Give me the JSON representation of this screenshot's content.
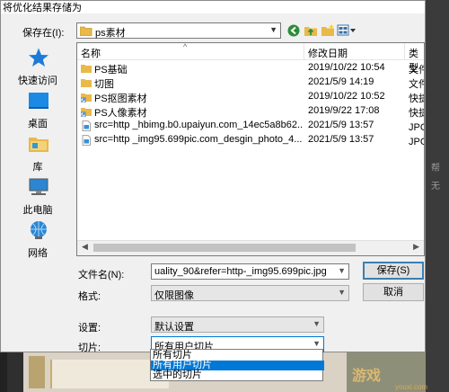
{
  "window": {
    "title": "将优化结果存储为"
  },
  "save_in": {
    "label": "保存在(I):",
    "value": "ps素材"
  },
  "places": [
    {
      "label": "快速访问",
      "icon": "star-icon"
    },
    {
      "label": "桌面",
      "icon": "desktop-icon"
    },
    {
      "label": "库",
      "icon": "library-icon"
    },
    {
      "label": "此电脑",
      "icon": "computer-icon"
    },
    {
      "label": "网络",
      "icon": "network-icon"
    }
  ],
  "list": {
    "columns": {
      "name": "名称",
      "date": "修改日期",
      "type": "类型"
    },
    "rows": [
      {
        "name": "PS基础",
        "date": "2019/10/22 10:54",
        "type": "文件夹",
        "icon": "folder-icon"
      },
      {
        "name": "切图",
        "date": "2021/5/9 14:19",
        "type": "文件夹",
        "icon": "folder-icon"
      },
      {
        "name": "PS抠图素材",
        "date": "2019/10/22 10:52",
        "type": "快捷方",
        "icon": "shortcut-icon"
      },
      {
        "name": "PS人像素材",
        "date": "2019/9/22 17:08",
        "type": "快捷方",
        "icon": "shortcut-icon"
      },
      {
        "name": "src=http _hbimg.b0.upaiyun.com_14ec5a8b62...",
        "date": "2021/5/9 13:57",
        "type": "JPG 图",
        "icon": "image-file-icon"
      },
      {
        "name": "src=http _img95.699pic.com_desgin_photo_4...",
        "date": "2021/5/9 13:57",
        "type": "JPG 图",
        "icon": "image-file-icon"
      }
    ]
  },
  "filename": {
    "label": "文件名(N):",
    "value": "uality_90&refer=http-_img95.699pic.jpg"
  },
  "format": {
    "label": "格式:",
    "value": "仅限图像"
  },
  "buttons": {
    "save": "保存(S)",
    "cancel": "取消"
  },
  "settings": {
    "label": "设置:",
    "value": "默认设置"
  },
  "slices": {
    "label": "切片:",
    "value": "所有用户切片",
    "options": [
      "所有切片",
      "所有用户切片",
      "选中的切片"
    ],
    "selected_index": 1
  },
  "background": {
    "side_text": [
      "ᐩ",
      "帮",
      "无"
    ],
    "watermark": "游戏",
    "watermark_small": "youxi.com"
  },
  "colors": {
    "selection": "#0078d7",
    "default_button_border": "#3c7fb1"
  }
}
